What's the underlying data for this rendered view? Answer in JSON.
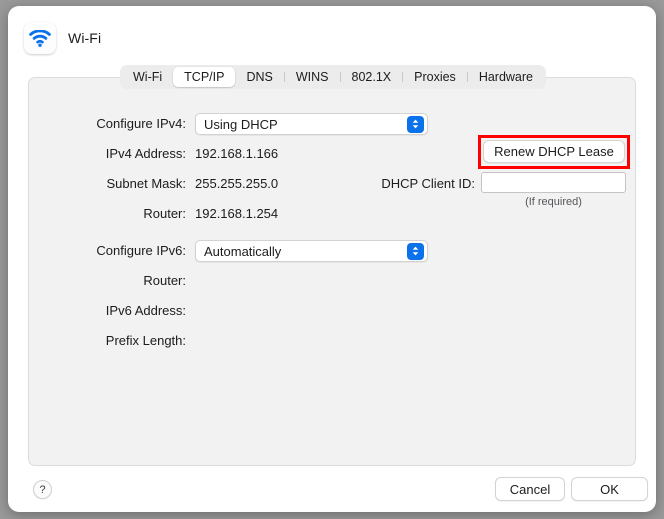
{
  "window": {
    "icon_name": "wifi-icon",
    "title": "Wi-Fi"
  },
  "tabs": [
    {
      "label": "Wi-Fi",
      "selected": false
    },
    {
      "label": "TCP/IP",
      "selected": true
    },
    {
      "label": "DNS",
      "selected": false
    },
    {
      "label": "WINS",
      "selected": false
    },
    {
      "label": "802.1X",
      "selected": false
    },
    {
      "label": "Proxies",
      "selected": false
    },
    {
      "label": "Hardware",
      "selected": false
    }
  ],
  "ipv4": {
    "configure_label": "Configure IPv4:",
    "configure_value": "Using DHCP",
    "address_label": "IPv4 Address:",
    "address_value": "192.168.1.166",
    "subnet_label": "Subnet Mask:",
    "subnet_value": "255.255.255.0",
    "router_label": "Router:",
    "router_value": "192.168.1.254"
  },
  "dhcp": {
    "renew_button": "Renew DHCP Lease",
    "client_id_label": "DHCP Client ID:",
    "client_id_value": "",
    "client_id_placeholder": "",
    "client_id_caption": "(If required)"
  },
  "ipv6": {
    "configure_label": "Configure IPv6:",
    "configure_value": "Automatically",
    "router_label": "Router:",
    "router_value": "",
    "address_label": "IPv6 Address:",
    "address_value": "",
    "prefix_label": "Prefix Length:",
    "prefix_value": ""
  },
  "footer": {
    "help_label": "?",
    "cancel_label": "Cancel",
    "ok_label": "OK"
  },
  "colors": {
    "accent": "#0b72ec",
    "highlight": "#ff0000",
    "panel_bg": "#f2f2f2",
    "window_bg": "#ffffff"
  }
}
